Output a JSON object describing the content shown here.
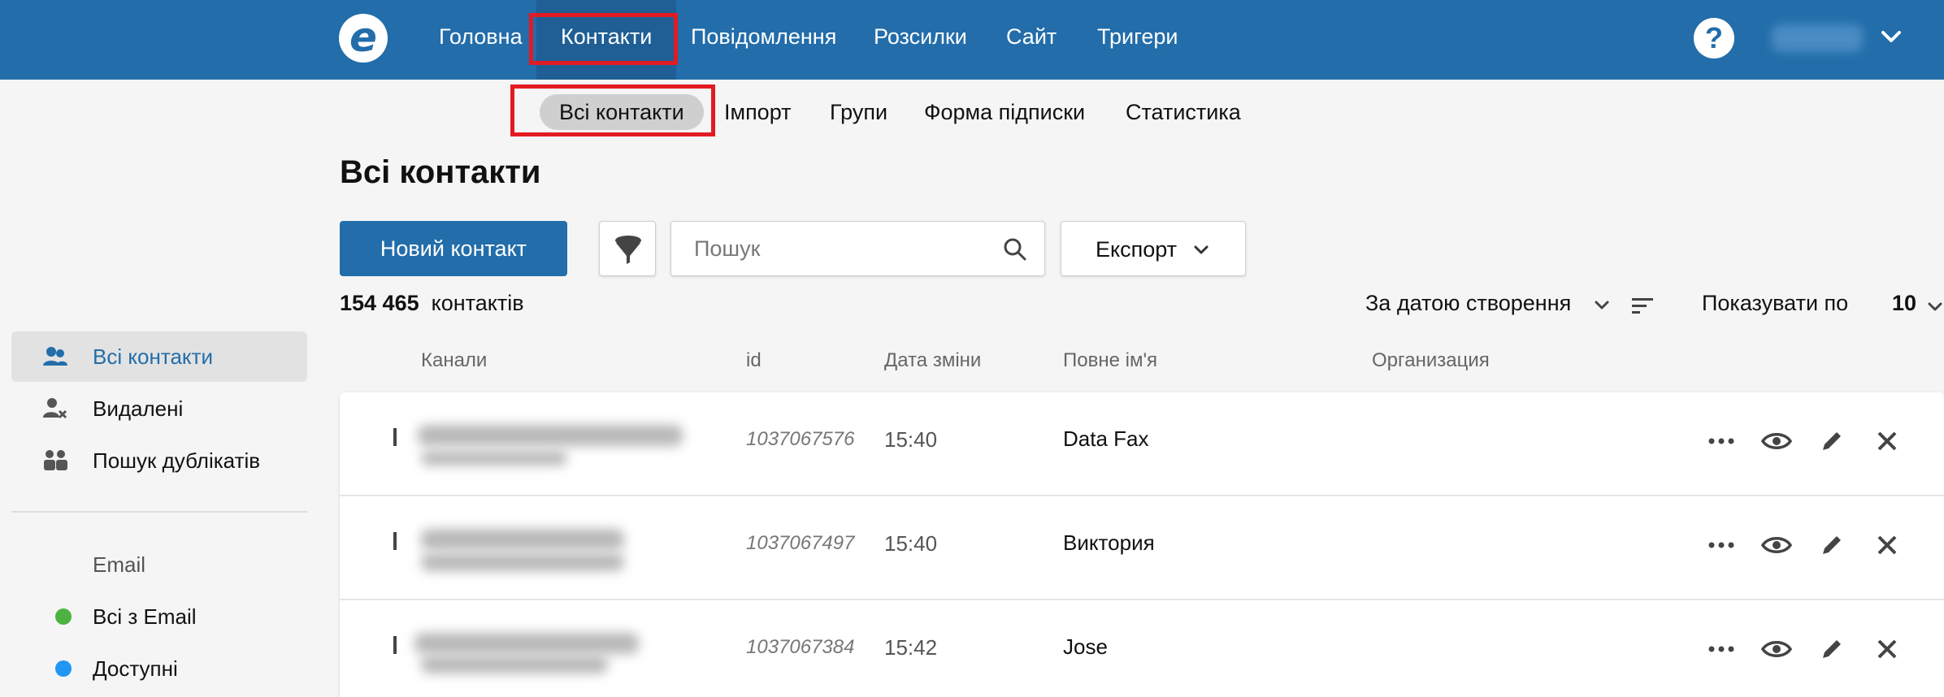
{
  "colors": {
    "brand": "#226daa",
    "highlight": "#e21b22",
    "dot_green": "#4cb340",
    "dot_blue": "#2196f3"
  },
  "topnav": {
    "items": [
      {
        "label": "Головна"
      },
      {
        "label": "Контакти"
      },
      {
        "label": "Повідомлення"
      },
      {
        "label": "Розсилки"
      },
      {
        "label": "Сайт"
      },
      {
        "label": "Тригери"
      }
    ],
    "help_label": "?"
  },
  "subnav": {
    "items": [
      {
        "label": "Всі контакти"
      },
      {
        "label": "Імпорт"
      },
      {
        "label": "Групи"
      },
      {
        "label": "Форма підписки"
      },
      {
        "label": "Статистика"
      }
    ]
  },
  "page": {
    "title": "Всі контакти",
    "new_contact_label": "Новий контакт",
    "search_placeholder": "Пошук",
    "export_label": "Експорт",
    "count_number": "154 465",
    "count_suffix": "контактів",
    "sort_label": "За датою створення",
    "per_page_label": "Показувати по",
    "per_page_value": "10"
  },
  "sidebar": {
    "items": [
      {
        "label": "Всі контакти",
        "icon": "users-icon"
      },
      {
        "label": "Видалені",
        "icon": "user-remove-icon"
      },
      {
        "label": "Пошук дублікатів",
        "icon": "duplicates-icon"
      }
    ],
    "email_heading": "Email",
    "email_items": [
      {
        "label": "Всі з Email",
        "status_color": "#4cb340"
      },
      {
        "label": "Доступні",
        "status_color": "#2196f3"
      }
    ]
  },
  "table": {
    "columns": [
      "Канали",
      "id",
      "Дата зміни",
      "Повне ім'я",
      "Организация"
    ],
    "rows": [
      {
        "id": "1037067576",
        "time": "15:40",
        "name": "Data Fax"
      },
      {
        "id": "1037067497",
        "time": "15:40",
        "name": "Виктория"
      },
      {
        "id": "1037067384",
        "time": "15:42",
        "name": "Jose"
      }
    ]
  }
}
